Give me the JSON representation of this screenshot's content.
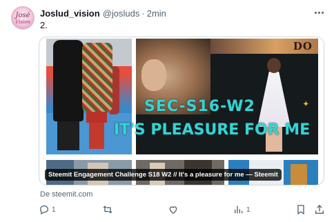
{
  "tweet": {
    "author_name": "Joslud_vision",
    "handle": "@josluds",
    "separator": "·",
    "time": "2min",
    "text": "2.",
    "avatar_text_1": "José",
    "avatar_text_2": "Vision"
  },
  "card": {
    "overlay_title": "SEC-S16-W2",
    "overlay_subtitle": "IT'S PLEASURE FOR ME",
    "banner_text": "DO",
    "caption": "Steemit Engagement Challenge S18 W2 // It's a pleasure for me — Steemit",
    "source": "De steemit.com"
  },
  "actions": {
    "reply_count": "1",
    "retweet_count": "",
    "like_count": "",
    "views_count": "1"
  },
  "colors": {
    "text_primary": "#0f1419",
    "text_secondary": "#536471",
    "border": "#cfd9de",
    "overlay_text": "#35d4d4"
  },
  "icons": [
    "more-icon",
    "reply-icon",
    "retweet-icon",
    "like-icon",
    "views-icon",
    "bookmark-icon",
    "share-icon"
  ]
}
